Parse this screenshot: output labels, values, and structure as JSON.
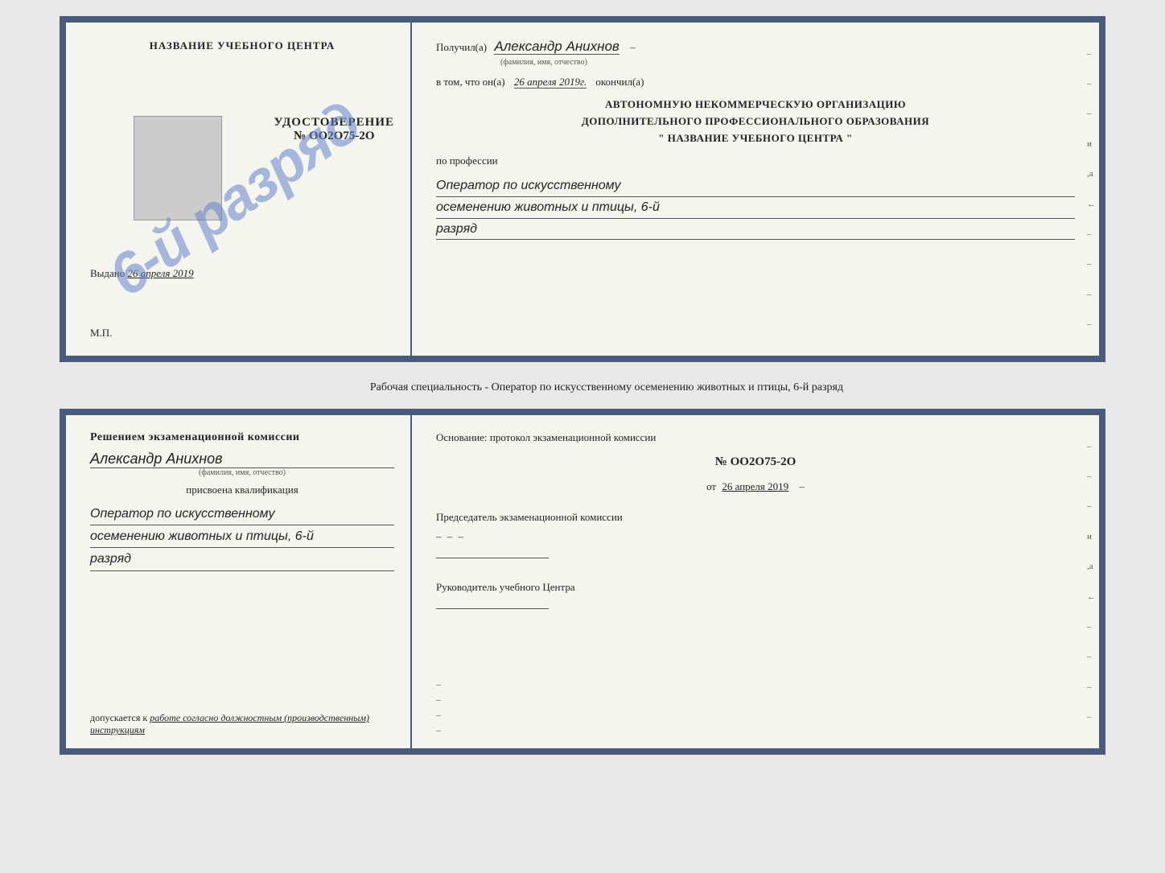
{
  "top_cert": {
    "left": {
      "org_name": "НАЗВАНИЕ УЧЕБНОГО ЦЕНТРА",
      "stamp_text": "6-й разряд",
      "udostoverenie_label": "УДОСТОВЕРЕНИЕ",
      "udostoverenie_num": "№ OO2O75-2O",
      "vydano_label": "Выдано",
      "vydano_date": "26 апреля 2019",
      "mp_label": "М.П."
    },
    "right": {
      "received_label": "Получил(а)",
      "received_name": "Александр Анихнов",
      "fio_caption": "(фамилия, имя, отчество)",
      "dash1": "–",
      "in_that_label": "в том, что он(а)",
      "completion_date": "26 апреля 2019г.",
      "finished_label": "окончил(а)",
      "dash2": "–",
      "org_line1": "АВТОНОМНУЮ НЕКОММЕРЧЕСКУЮ ОРГАНИЗАЦИЮ",
      "org_line2": "ДОПОЛНИТЕЛЬНОГО ПРОФЕССИОНАЛЬНОГО ОБРАЗОВАНИЯ",
      "org_line3": "\"   НАЗВАНИЕ УЧЕБНОГО ЦЕНТРА   \"",
      "dash3": "–",
      "and_label": "и",
      "a_label": ",а",
      "arrow_label": "←",
      "profession_label": "по профессии",
      "profession_line1": "Оператор по искусственному",
      "profession_line2": "осеменению животных и птицы, 6-й",
      "profession_line3": "разряд",
      "dash4": "–",
      "dash5": "–",
      "dash6": "–",
      "dash7": "–"
    }
  },
  "middle_caption": "Рабочая специальность - Оператор по искусственному осеменению животных и птицы, 6-й разряд",
  "bottom_cert": {
    "left": {
      "resolution_title": "Решением экзаменационной комиссии",
      "name": "Александр Анихнов",
      "fio_caption": "(фамилия, имя, отчество)",
      "assigned_label": "присвоена квалификация",
      "qual_line1": "Оператор по искусственному",
      "qual_line2": "осеменению животных и птицы, 6-й",
      "qual_line3": "разряд",
      "допускается_label": "допускается к",
      "допускается_text": "работе согласно должностным (производственным) инструкциям"
    },
    "right": {
      "osnov_label": "Основание: протокол экзаменационной комиссии",
      "protocol_num": "№  OO2O75-2O",
      "protocol_date_prefix": "от",
      "protocol_date": "26 апреля 2019",
      "dash1": "–",
      "dash2": "–",
      "dash3": "–",
      "chairman_label": "Председатель экзаменационной комиссии",
      "and_label": "и",
      "a_label": ",а",
      "arrow_label": "←",
      "director_label": "Руководитель учебного Центра",
      "dash4": "–",
      "dash5": "–",
      "dash6": "–",
      "dash7": "–"
    }
  }
}
